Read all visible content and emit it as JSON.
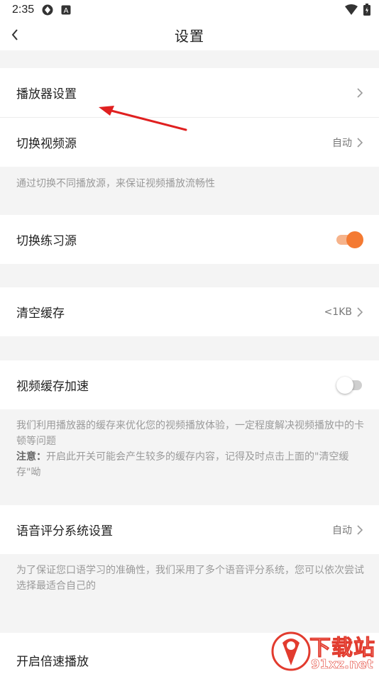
{
  "status_bar": {
    "time": "2:35",
    "icons": [
      "vpn-icon",
      "app-a-icon",
      "wifi-icon",
      "battery-icon"
    ]
  },
  "header": {
    "title": "设置",
    "back_icon": "chevron-left-icon"
  },
  "rows": {
    "player_settings": {
      "label": "播放器设置"
    },
    "switch_video_source": {
      "label": "切换视频源",
      "value": "自动"
    },
    "switch_practice_source": {
      "label": "切换练习源",
      "toggle": true
    },
    "clear_cache": {
      "label": "清空缓存",
      "value": "<1KB"
    },
    "video_cache_speedup": {
      "label": "视频缓存加速",
      "toggle": false
    },
    "voice_scoring": {
      "label": "语音评分系统设置",
      "value": "自动"
    },
    "speed_playback": {
      "label": "开启倍速播放"
    }
  },
  "notes": {
    "video_source": "通过切换不同播放源，来保证视频播放流畅性",
    "cache_line": "我们利用播放器的缓存来优化您的视频播放体验，一定程度解决视频播放中的卡顿等问题",
    "cache_warning_title": "注意：",
    "cache_warning_text": "开启此开关可能会产生较多的缓存内容，记得及时点击上面的\"清空缓存\"呦",
    "voice_scoring": "为了保证您口语学习的准确性，我们采用了多个语音评分系统，您可以依次尝试选择最适合自己的"
  },
  "watermark": {
    "line1": "下载站",
    "line2": "91xz.net"
  },
  "colors": {
    "accent": "#f47a32",
    "accent_light": "#f6b38b",
    "annotation_arrow": "#e02020",
    "watermark_red": "#e23b2e"
  }
}
